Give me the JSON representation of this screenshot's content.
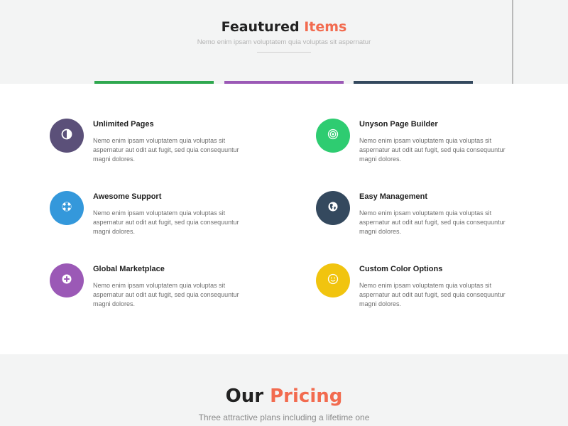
{
  "featured": {
    "title_main": "Feautured",
    "title_accent": "Items",
    "subtitle": "Nemo enim ipsam voluptatem quia voluptas sit aspernatur"
  },
  "bars": {
    "colors": [
      "#2fa84f",
      "#9b59b6",
      "#34495e"
    ]
  },
  "features": [
    {
      "title": "Unlimited Pages",
      "desc": "Nemo enim ipsam voluptatem quia voluptas sit aspernatur aut odit aut fugit, sed quia consequuntur magni dolores.",
      "icon": "contrast-icon",
      "color": "#5b5079"
    },
    {
      "title": "Unyson Page Builder",
      "desc": "Nemo enim ipsam voluptatem quia voluptas sit aspernatur aut odit aut fugit, sed quia consequuntur magni dolores.",
      "icon": "target-icon",
      "color": "#2ecc71"
    },
    {
      "title": "Awesome Support",
      "desc": "Nemo enim ipsam voluptatem quia voluptas sit aspernatur aut odit aut fugit, sed quia consequuntur magni dolores.",
      "icon": "lifebuoy-icon",
      "color": "#3498db"
    },
    {
      "title": "Easy Management",
      "desc": "Nemo enim ipsam voluptatem quia voluptas sit aspernatur aut odit aut fugit, sed quia consequuntur magni dolores.",
      "icon": "globe-icon",
      "color": "#34495e"
    },
    {
      "title": "Global Marketplace",
      "desc": "Nemo enim ipsam voluptatem quia voluptas sit aspernatur aut odit aut fugit, sed quia consequuntur magni dolores.",
      "icon": "plus-circle-icon",
      "color": "#9b59b6"
    },
    {
      "title": "Custom Color Options",
      "desc": "Nemo enim ipsam voluptatem quia voluptas sit aspernatur aut odit aut fugit, sed quia consequuntur magni dolores.",
      "icon": "smile-icon",
      "color": "#f1c40f"
    }
  ],
  "pricing": {
    "title_main": "Our",
    "title_accent": "Pricing",
    "subtitle": "Three attractive plans including a lifetime one"
  },
  "colors": {
    "accent": "#f26b4f",
    "section_bg": "#f3f4f4",
    "text_dark": "#222222",
    "text_muted": "#6e6e6e"
  }
}
